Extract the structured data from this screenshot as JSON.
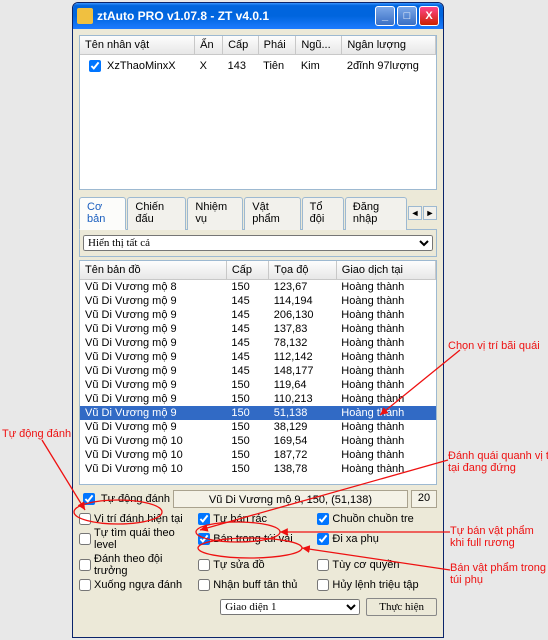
{
  "window": {
    "title": "ztAuto PRO v1.07.8 - ZT v4.0.1"
  },
  "charTable": {
    "headers": [
      "Tên nhân vật",
      "Ẩn",
      "Cấp",
      "Phái",
      "Ngũ...",
      "Ngân lượng"
    ],
    "rows": [
      {
        "checked": true,
        "name": "XzThaoMinxX",
        "hidden": "X",
        "level": "143",
        "class": "Tiên",
        "faction": "Kim",
        "money": "2đĩnh 97lượng"
      }
    ]
  },
  "tabs": [
    "Cơ bản",
    "Chiến đấu",
    "Nhiệm vụ",
    "Vật phẩm",
    "Tổ đội",
    "Đăng nhập"
  ],
  "activeTab": 0,
  "filterSelect": "Hiển thị tất cả",
  "mapTable": {
    "headers": [
      "Tên bản đồ",
      "Cấp",
      "Tọa độ",
      "Giao dịch tại"
    ],
    "rows": [
      {
        "map": "Vũ Di Vương mộ 8",
        "lvl": "150",
        "coord": "123,67",
        "trade": "Hoàng thành"
      },
      {
        "map": "Vũ Di Vương mộ 9",
        "lvl": "145",
        "coord": "114,194",
        "trade": "Hoàng thành"
      },
      {
        "map": "Vũ Di Vương mộ 9",
        "lvl": "145",
        "coord": "206,130",
        "trade": "Hoàng thành"
      },
      {
        "map": "Vũ Di Vương mộ 9",
        "lvl": "145",
        "coord": "137,83",
        "trade": "Hoàng thành"
      },
      {
        "map": "Vũ Di Vương mộ 9",
        "lvl": "145",
        "coord": "78,132",
        "trade": "Hoàng thành"
      },
      {
        "map": "Vũ Di Vương mộ 9",
        "lvl": "145",
        "coord": "112,142",
        "trade": "Hoàng thành"
      },
      {
        "map": "Vũ Di Vương mộ 9",
        "lvl": "145",
        "coord": "148,177",
        "trade": "Hoàng thành"
      },
      {
        "map": "Vũ Di Vương mộ 9",
        "lvl": "150",
        "coord": "119,64",
        "trade": "Hoàng thành"
      },
      {
        "map": "Vũ Di Vương mộ 9",
        "lvl": "150",
        "coord": "110,213",
        "trade": "Hoàng thành"
      },
      {
        "map": "Vũ Di Vương mộ 9",
        "lvl": "150",
        "coord": "51,138",
        "trade": "Hoàng thành",
        "selected": true
      },
      {
        "map": "Vũ Di Vương mộ 9",
        "lvl": "150",
        "coord": "38,129",
        "trade": "Hoàng thành"
      },
      {
        "map": "Vũ Di Vương mộ 10",
        "lvl": "150",
        "coord": "169,54",
        "trade": "Hoàng thành"
      },
      {
        "map": "Vũ Di Vương mộ 10",
        "lvl": "150",
        "coord": "187,72",
        "trade": "Hoàng thành"
      },
      {
        "map": "Vũ Di Vương mộ 10",
        "lvl": "150",
        "coord": "138,78",
        "trade": "Hoàng thành"
      }
    ]
  },
  "locBox": "Vũ Di Vương mộ 9, 150, (51,138)",
  "locNum": "20",
  "options": {
    "r1": [
      {
        "label": "Tự động đánh",
        "checked": true
      },
      {
        "label": "",
        "checked": false,
        "blank": true
      },
      {
        "label": "",
        "checked": false,
        "blank": true
      }
    ],
    "r2": [
      {
        "label": "Vị trí đánh hiện tại",
        "checked": false
      },
      {
        "label": "Tự bán rác",
        "checked": true
      },
      {
        "label": "Chuồn chuồn tre",
        "checked": true
      }
    ],
    "r3": [
      {
        "label": "Tự tìm quái theo level",
        "checked": false
      },
      {
        "label": "Bán trong túi vải",
        "checked": true
      },
      {
        "label": "Đi xa phụ",
        "checked": true
      }
    ],
    "r4": [
      {
        "label": "Đánh theo đội trưởng",
        "checked": false
      },
      {
        "label": "Tự sửa đồ",
        "checked": false
      },
      {
        "label": "Tùy cơ quyền",
        "checked": false
      }
    ],
    "r5": [
      {
        "label": "Xuống ngựa đánh",
        "checked": false
      },
      {
        "label": "Nhận buff tân thủ",
        "checked": false
      },
      {
        "label": "Hủy lệnh triệu tập",
        "checked": false
      }
    ]
  },
  "bottom": {
    "select": "Giao diện 1",
    "button": "Thực hiện"
  },
  "annotations": {
    "a1": "Chọn vị trí bãi quái",
    "a2": "Tự động đánh",
    "a3": "Đánh quái quanh vị trí hiện\ntại đang đứng",
    "a4": "Tự bán vật phẩm\nkhi full rương",
    "a5": "Bán vật phẩm trong\ntúi phụ"
  }
}
